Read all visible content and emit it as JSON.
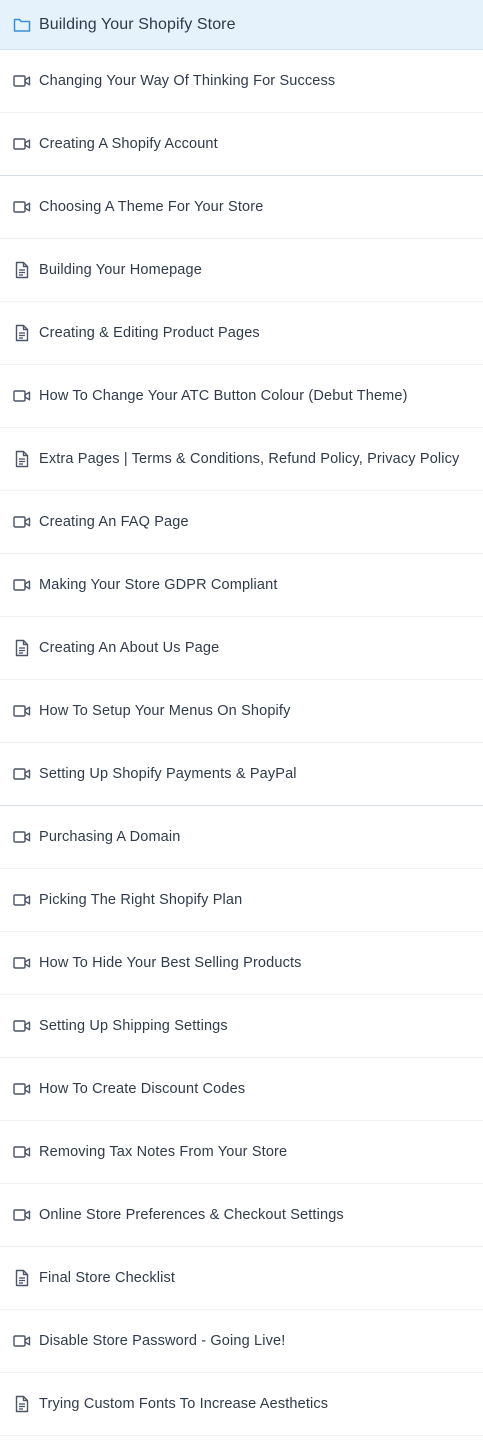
{
  "section": {
    "title": "Building Your Shopify Store",
    "icon": "folder-icon"
  },
  "lessons": [
    {
      "label": "Changing Your Way Of Thinking For Success",
      "icon": "video-icon"
    },
    {
      "label": "Creating A Shopify Account",
      "icon": "video-icon"
    },
    {
      "label": "Choosing A Theme For Your Store",
      "icon": "video-icon"
    },
    {
      "label": "Building Your Homepage",
      "icon": "document-icon"
    },
    {
      "label": "Creating & Editing Product Pages",
      "icon": "document-icon"
    },
    {
      "label": "How To Change Your ATC Button Colour (Debut Theme)",
      "icon": "video-icon"
    },
    {
      "label": "Extra Pages | Terms & Conditions, Refund Policy, Privacy Policy",
      "icon": "document-icon"
    },
    {
      "label": "Creating An FAQ Page",
      "icon": "video-icon"
    },
    {
      "label": "Making Your Store GDPR Compliant",
      "icon": "video-icon"
    },
    {
      "label": "Creating An About Us Page",
      "icon": "document-icon"
    },
    {
      "label": "How To Setup Your Menus On Shopify",
      "icon": "video-icon"
    },
    {
      "label": "Setting Up Shopify Payments & PayPal",
      "icon": "video-icon"
    },
    {
      "label": "Purchasing A Domain",
      "icon": "video-icon"
    },
    {
      "label": "Picking The Right Shopify Plan",
      "icon": "video-icon"
    },
    {
      "label": "How To Hide Your Best Selling Products",
      "icon": "video-icon"
    },
    {
      "label": "Setting Up Shipping Settings",
      "icon": "video-icon"
    },
    {
      "label": "How To Create Discount Codes",
      "icon": "video-icon"
    },
    {
      "label": "Removing Tax Notes From Your Store",
      "icon": "video-icon"
    },
    {
      "label": "Online Store Preferences & Checkout Settings",
      "icon": "video-icon"
    },
    {
      "label": "Final Store Checklist",
      "icon": "document-icon"
    },
    {
      "label": "Disable Store Password - Going Live!",
      "icon": "video-icon"
    },
    {
      "label": "Trying Custom Fonts To Increase Aesthetics",
      "icon": "document-icon"
    }
  ],
  "colors": {
    "header_bg": "#e5f2fb",
    "folder_icon": "#3b8fd4",
    "item_icon": "#4a5568",
    "text": "#2f3b4b"
  }
}
